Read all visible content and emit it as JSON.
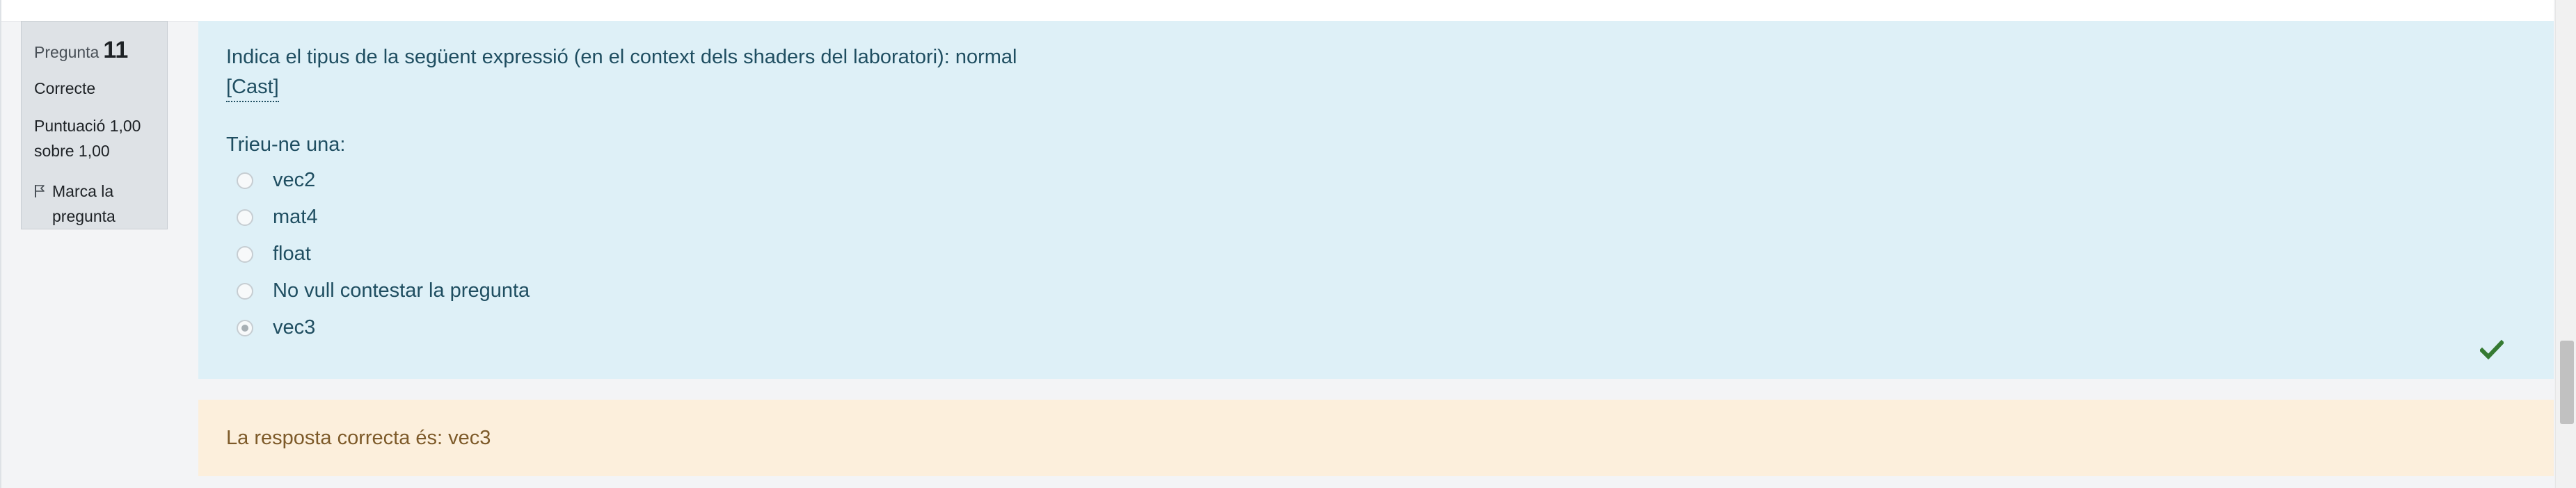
{
  "question_info": {
    "label": "Pregunta",
    "number": "11",
    "state": "Correcte",
    "grade": "Puntuació 1,00 sobre 1,00",
    "flag_label": "Marca la pregunta"
  },
  "formulation": {
    "question_text": "Indica el tipus de la següent expressió (en el context dels shaders del laboratori): normal",
    "cast_link": "[Cast]",
    "prompt": "Trieu-ne una:",
    "answers": [
      {
        "label": "vec2",
        "selected": false
      },
      {
        "label": "mat4",
        "selected": false
      },
      {
        "label": "float",
        "selected": false
      },
      {
        "label": "No vull contestar la pregunta",
        "selected": false
      },
      {
        "label": "vec3",
        "selected": true
      }
    ],
    "correct_icon": "check-icon"
  },
  "outcome": {
    "right_answer": "La resposta correcta és: vec3"
  },
  "colors": {
    "formulation_bg": "#def0f7",
    "outcome_bg": "#fcefdc",
    "info_bg": "#dee2e6",
    "check_color": "#357a32"
  }
}
